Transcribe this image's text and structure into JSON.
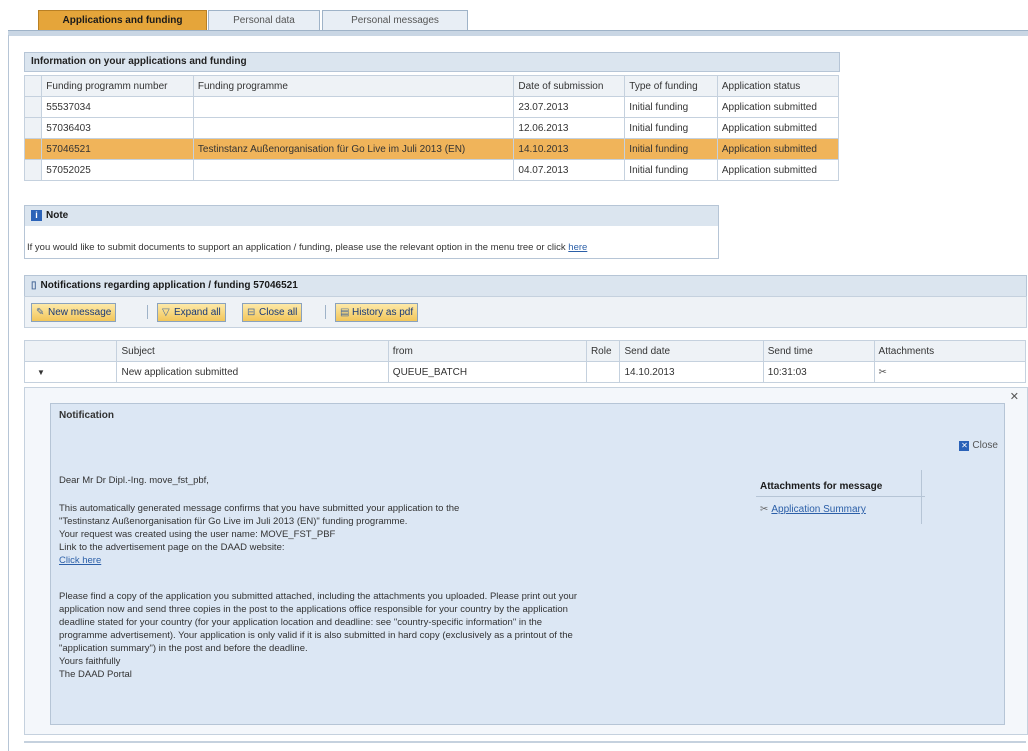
{
  "tabs": [
    {
      "label": "Applications and funding",
      "active": true
    },
    {
      "label": "Personal data",
      "active": false
    },
    {
      "label": "Personal messages",
      "active": false
    }
  ],
  "applications": {
    "title": "Information on your applications and funding",
    "columns": [
      "Funding programm number",
      "Funding programme",
      "Date of submission",
      "Type of funding",
      "Application status"
    ],
    "rows": [
      [
        "55537034",
        "",
        "23.07.2013",
        "Initial funding",
        "Application submitted"
      ],
      [
        "57036403",
        "",
        "12.06.2013",
        "Initial funding",
        "Application submitted"
      ],
      [
        "57046521",
        "Testinstanz Außenorganisation für Go Live im Juli 2013 (EN)",
        "14.10.2013",
        "Initial funding",
        "Application submitted"
      ],
      [
        "57052025",
        "",
        "04.07.2013",
        "Initial funding",
        "Application submitted"
      ]
    ],
    "highlighted_row": 2
  },
  "note": {
    "title": "Note",
    "text": "If you would like to submit documents to support an application / funding, please use the relevant option in the menu tree or click",
    "link": "here"
  },
  "notifications": {
    "title": "Notifications regarding application / funding 57046521",
    "toolbar": {
      "new_message": "New message",
      "expand_all": "Expand all",
      "close_all": "Close all",
      "history": "History as pdf"
    },
    "columns": [
      "",
      "Subject",
      "from",
      "Role",
      "Send date",
      "Send time",
      "Attachments"
    ],
    "row": {
      "subject": "New application submitted",
      "from": "QUEUE_BATCH",
      "role": "",
      "send_date": "14.10.2013",
      "send_time": "10:31:03"
    }
  },
  "detail": {
    "title": "Notification",
    "close_label": "Close",
    "greeting": "Dear Mr Dr Dipl.-Ing. move_fst_pbf,",
    "para1": [
      "This automatically generated message confirms that you have submitted your application to the",
      "\"Testinstanz Außenorganisation für Go Live im Juli 2013 (EN)\" funding programme.",
      "Your request was created using the user name: MOVE_FST_PBF",
      "Link to the advertisement page on the DAAD website:"
    ],
    "click_here": "Click here",
    "para2": [
      "Please find a copy of the application you submitted attached, including the attachments you uploaded. Please print out your",
      "application now and send three copies in the post to the applications office responsible for your country by the application",
      "deadline stated for your country (for your application location and deadline: see \"country-specific information\" in the",
      "programme advertisement). Your application is only valid if it is also submitted in hard copy (exclusively as a printout of the",
      "\"application summary\") in the post and before the deadline.",
      "Yours faithfully",
      "The DAAD Portal"
    ],
    "attachments_title": "Attachments for message",
    "attachment_link": "Application Summary"
  }
}
